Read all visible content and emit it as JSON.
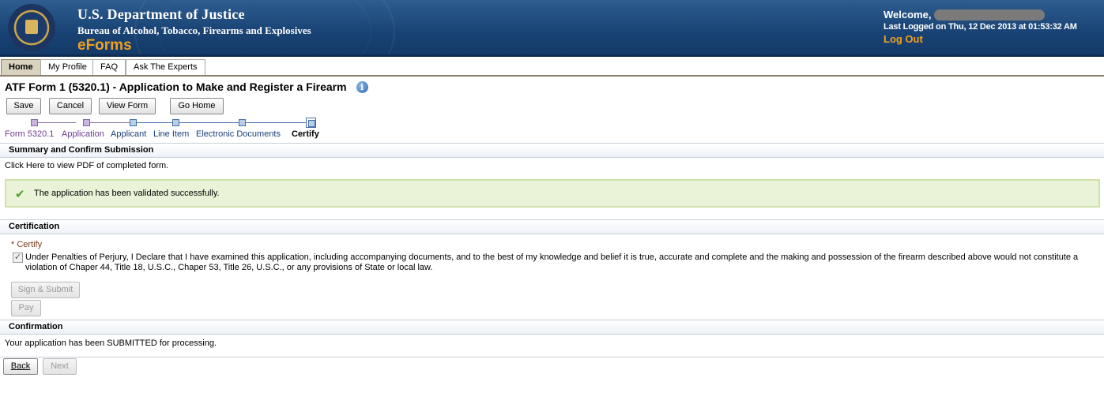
{
  "header": {
    "agency_line1": "U.S. Department of Justice",
    "agency_line2": "Bureau of Alcohol, Tobacco, Firearms and Explosives",
    "product": "eForms",
    "welcome_label": "Welcome,",
    "last_logged": "Last Logged on Thu, 12 Dec 2013 at 01:53:32 AM",
    "logout_label": "Log Out",
    "accent_color": "#f0a020"
  },
  "tabs": [
    {
      "label": "Home",
      "active": true
    },
    {
      "label": "My Profile",
      "active": false
    },
    {
      "label": "FAQ",
      "active": false
    },
    {
      "label": "Ask The Experts",
      "active": false
    }
  ],
  "page_title": "ATF Form 1 (5320.1) - Application to Make and Register a Firearm",
  "toolbar": {
    "save_label": "Save",
    "cancel_label": "Cancel",
    "view_form_label": "View Form",
    "go_home_label": "Go Home"
  },
  "train": [
    {
      "label": "Form 5320.1",
      "state": "visited"
    },
    {
      "label": "Application",
      "state": "visited"
    },
    {
      "label": "Applicant",
      "state": "next"
    },
    {
      "label": "Line Item",
      "state": "next"
    },
    {
      "label": "Electronic Documents",
      "state": "next"
    },
    {
      "label": "Certify",
      "state": "current"
    }
  ],
  "summary": {
    "heading": "Summary and Confirm Submission",
    "pdf_link": "Click Here to view PDF of completed form.",
    "success_message": "The application has been validated successfully."
  },
  "certification": {
    "heading": "Certification",
    "required_label": "* Certify",
    "checked": true,
    "statement": "Under Penalties of Perjury, I Declare that I have examined this application, including accompanying documents, and to the best of my knowledge and belief it is true, accurate and complete and the making and possession of the firearm described above would not constitute a violation of Chaper 44, Title 18, U.S.C., Chaper 53, Title 26, U.S.C., or any provisions of State or local law.",
    "sign_submit_label": "Sign & Submit",
    "pay_label": "Pay"
  },
  "confirmation": {
    "heading": "Confirmation",
    "message": "Your application has been SUBMITTED for processing."
  },
  "nav": {
    "back_label": "Back",
    "next_label": "Next"
  }
}
